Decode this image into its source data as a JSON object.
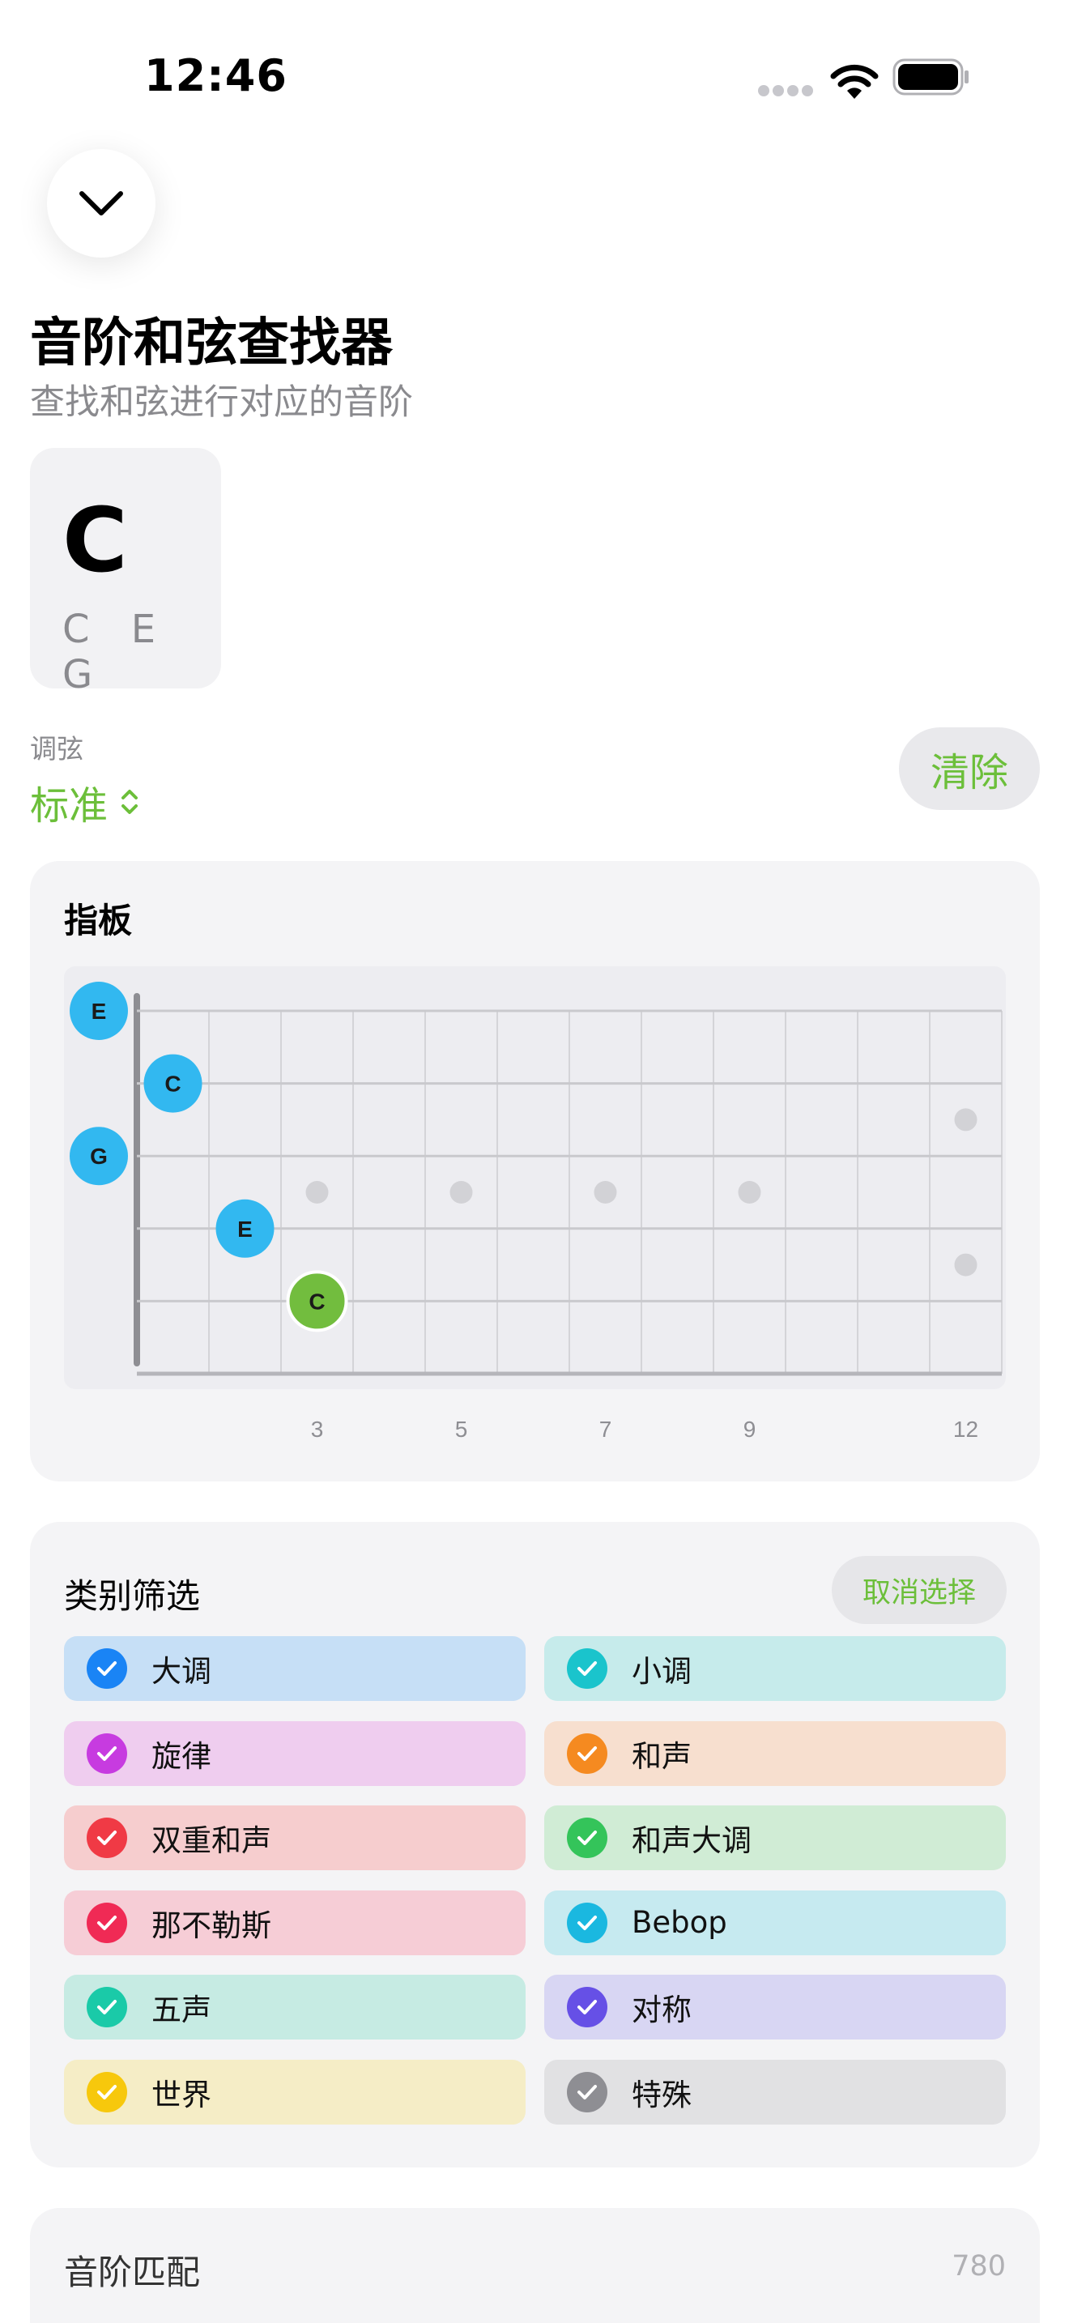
{
  "status": {
    "time": "12:46"
  },
  "header": {
    "title": "音阶和弦查找器",
    "subtitle": "查找和弦进行对应的音阶"
  },
  "chord": {
    "name": "C",
    "notes": "C E G"
  },
  "tuning": {
    "label": "调弦",
    "value": "标准"
  },
  "clear_label": "清除",
  "fretboard": {
    "title": "指板",
    "fret_numbers": [
      "3",
      "5",
      "7",
      "9",
      "12"
    ],
    "notes": [
      {
        "label": "E",
        "string": 1,
        "fret": 0,
        "color": "#32b8f0"
      },
      {
        "label": "C",
        "string": 2,
        "fret": 1,
        "color": "#32b8f0"
      },
      {
        "label": "G",
        "string": 3,
        "fret": 0,
        "color": "#32b8f0"
      },
      {
        "label": "E",
        "string": 4,
        "fret": 2,
        "color": "#32b8f0"
      },
      {
        "label": "C",
        "string": 5,
        "fret": 3,
        "color": "#72bd3e"
      }
    ]
  },
  "filter": {
    "title": "类别筛选",
    "deselect_label": "取消选择",
    "categories": [
      {
        "label": "大调",
        "color": "#1a84f5",
        "bg": "#c6dff6"
      },
      {
        "label": "小调",
        "color": "#1ac4cc",
        "bg": "#c6ebeb"
      },
      {
        "label": "旋律",
        "color": "#c73be0",
        "bg": "#efcdef"
      },
      {
        "label": "和声",
        "color": "#f58a20",
        "bg": "#f7dfcf"
      },
      {
        "label": "双重和声",
        "color": "#f03a45",
        "bg": "#f6cdce"
      },
      {
        "label": "和声大调",
        "color": "#34c45a",
        "bg": "#d0ecd5"
      },
      {
        "label": "那不勒斯",
        "color": "#f02a55",
        "bg": "#f6cdd6"
      },
      {
        "label": "Bebop",
        "color": "#1ab8e0",
        "bg": "#c6eaf0"
      },
      {
        "label": "五声",
        "color": "#1acaa8",
        "bg": "#c6ebe3"
      },
      {
        "label": "对称",
        "color": "#6650e6",
        "bg": "#d8d6f3"
      },
      {
        "label": "世界",
        "color": "#f7c80c",
        "bg": "#f5edc6"
      },
      {
        "label": "特殊",
        "color": "#8e8e93",
        "bg": "#e1e1e3"
      }
    ]
  },
  "match": {
    "title": "音阶匹配",
    "count": "780"
  }
}
